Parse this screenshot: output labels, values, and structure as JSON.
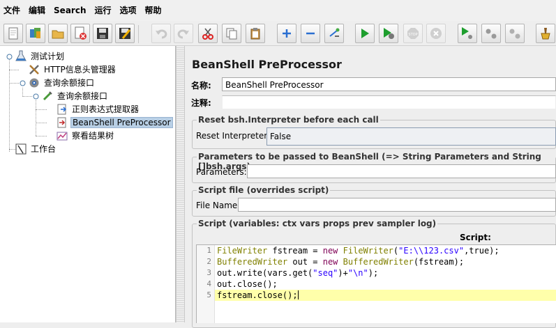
{
  "menubar": {
    "items": [
      "文件",
      "编辑",
      "Search",
      "运行",
      "选项",
      "帮助"
    ]
  },
  "toolbar": {
    "buttons": [
      {
        "icon": "new-icon",
        "enabled": true
      },
      {
        "icon": "templates-icon",
        "enabled": true
      },
      {
        "icon": "open-icon",
        "enabled": true
      },
      {
        "icon": "close-icon",
        "enabled": true
      },
      {
        "icon": "save-icon",
        "enabled": true
      },
      {
        "icon": "save-as-icon",
        "enabled": true
      },
      {
        "icon": "undo-icon",
        "enabled": false
      },
      {
        "icon": "redo-icon",
        "enabled": false
      },
      {
        "icon": "cut-icon",
        "enabled": true
      },
      {
        "icon": "copy-icon",
        "enabled": true
      },
      {
        "icon": "paste-icon",
        "enabled": true
      },
      {
        "icon": "expand-icon",
        "enabled": true
      },
      {
        "icon": "collapse-icon",
        "enabled": true
      },
      {
        "icon": "toggle-icon",
        "enabled": true
      },
      {
        "icon": "start-icon",
        "enabled": true
      },
      {
        "icon": "start-no-pauses-icon",
        "enabled": true
      },
      {
        "icon": "stop-icon",
        "enabled": false
      },
      {
        "icon": "shutdown-icon",
        "enabled": false
      },
      {
        "icon": "remote-start-icon",
        "enabled": true
      },
      {
        "icon": "remote-stop-icon",
        "enabled": true
      },
      {
        "icon": "remote-shutdown-icon",
        "enabled": true
      },
      {
        "icon": "clear-icon",
        "enabled": true
      }
    ]
  },
  "tree": {
    "nodes": [
      {
        "label": "测试计划",
        "icon": "test-plan-icon"
      },
      {
        "label": "HTTP信息头管理器",
        "icon": "header-manager-icon"
      },
      {
        "label": "查询余额接口",
        "icon": "thread-group-icon"
      },
      {
        "label": "查询余额接口",
        "icon": "sampler-icon"
      },
      {
        "label": "正则表达式提取器",
        "icon": "extractor-icon"
      },
      {
        "label": "BeanShell PreProcessor",
        "icon": "preprocessor-icon",
        "selected": true
      },
      {
        "label": "察看结果树",
        "icon": "listener-icon"
      },
      {
        "label": "工作台",
        "icon": "workbench-icon"
      }
    ]
  },
  "editor": {
    "title": "BeanShell PreProcessor",
    "name_label": "名称:",
    "name_value": "BeanShell PreProcessor",
    "comment_label": "注释:",
    "comment_value": "",
    "reset_group_title": "Reset bsh.Interpreter before each call",
    "reset_label": "Reset Interpreter:",
    "reset_value": "False",
    "params_group_title": "Parameters to be passed to BeanShell (=> String Parameters and String []bsh.args)",
    "params_label": "Parameters:",
    "params_value": "",
    "file_group_title": "Script file (overrides script)",
    "file_label": "File Name:",
    "file_value": "",
    "script_group_title": "Script (variables: ctx vars props prev sampler log)",
    "script_header": "Script:",
    "script_lines": [
      "FileWriter fstream = new FileWriter(\"E:\\\\123.csv\",true);",
      "BufferedWriter out = new BufferedWriter(fstream);",
      "out.write(vars.get(\"seq\")+\"\\n\");",
      "out.close();",
      "fstream.close();"
    ],
    "line_numbers": [
      "1",
      "2",
      "3",
      "4",
      "5"
    ]
  }
}
